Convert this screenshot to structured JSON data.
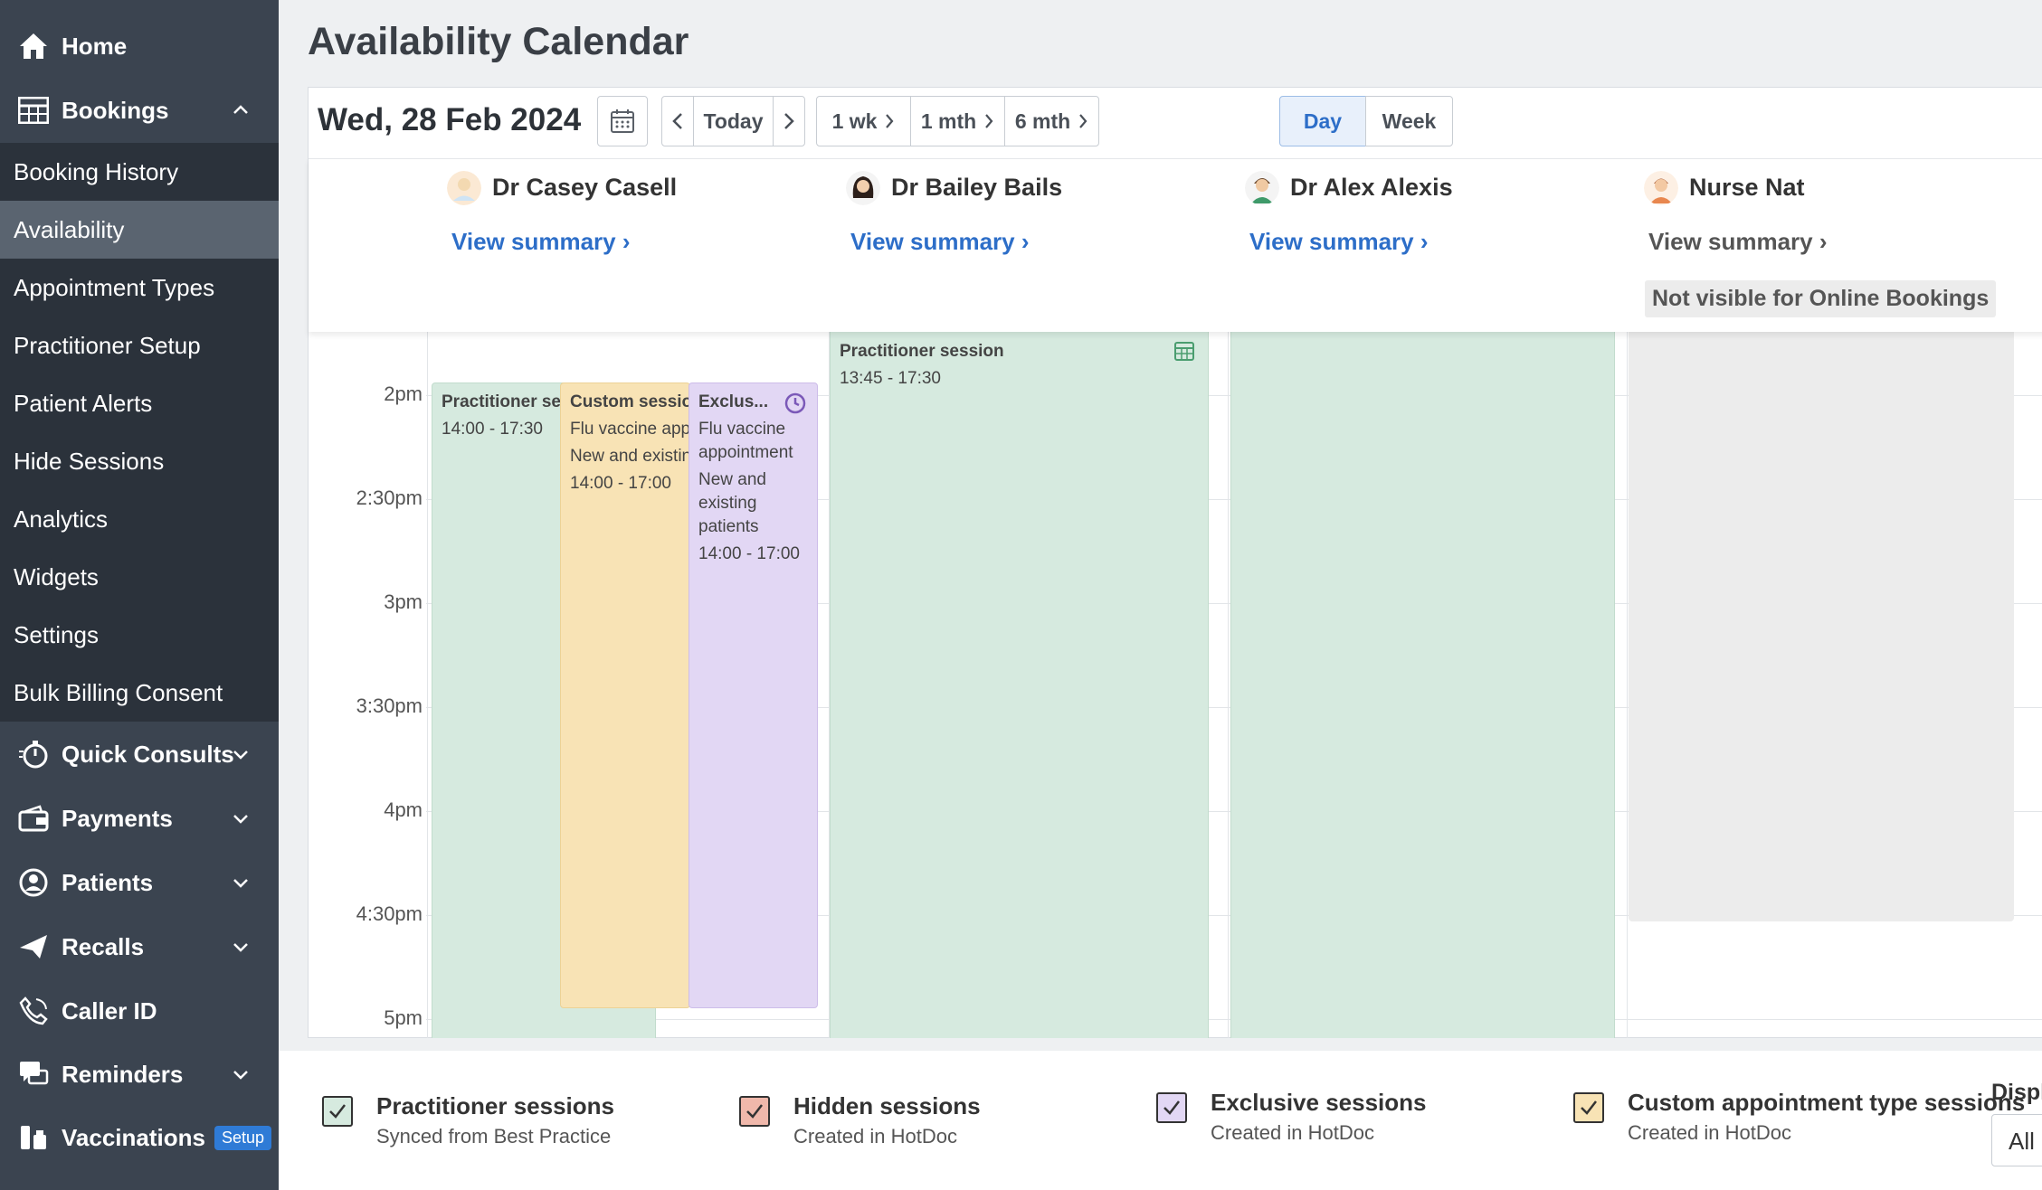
{
  "sidebar": {
    "home": "Home",
    "bookings": "Bookings",
    "bookings_sub": [
      "Booking History",
      "Availability",
      "Appointment Types",
      "Practitioner Setup",
      "Patient Alerts",
      "Hide Sessions",
      "Analytics",
      "Widgets",
      "Settings",
      "Bulk Billing Consent"
    ],
    "active_sub": "Availability",
    "quick_consults": "Quick Consults",
    "payments": "Payments",
    "patients": "Patients",
    "recalls": "Recalls",
    "caller_id": "Caller ID",
    "reminders": "Reminders",
    "vaccinations": "Vaccinations",
    "vaccinations_badge": "Setup"
  },
  "page": {
    "title": "Availability Calendar"
  },
  "toolbar": {
    "date": "Wed, 28 Feb 2024",
    "today": "Today",
    "ranges": [
      "1 wk",
      "1 mth",
      "6 mth"
    ],
    "views": [
      "Day",
      "Week"
    ],
    "active_view": "Day"
  },
  "practitioners": [
    {
      "name": "Dr Casey Casell",
      "link": "View summary"
    },
    {
      "name": "Dr Bailey Bails",
      "link": "View summary"
    },
    {
      "name": "Dr Alex Alexis",
      "link": "View summary"
    },
    {
      "name": "Nurse Nat",
      "link": "View summary",
      "notice": "Not visible for Online Bookings"
    }
  ],
  "times": [
    "2pm",
    "2:30pm",
    "3pm",
    "3:30pm",
    "4pm",
    "4:30pm",
    "5pm"
  ],
  "events": {
    "casey_practitioner": {
      "title": "Practitioner session",
      "time": "14:00 - 17:30"
    },
    "casey_custom": {
      "title": "Custom session",
      "line1": "Flu vaccine appointment",
      "line2": "New and existing patients",
      "time": "14:00 - 17:00"
    },
    "casey_exclusive": {
      "title": "Exclus...",
      "line1": "Flu vaccine appointment",
      "line2": "New and existing patients",
      "time": "14:00 - 17:00"
    },
    "bailey_practitioner": {
      "title": "Practitioner session",
      "time": "13:45 - 17:30"
    }
  },
  "legend": [
    {
      "title": "Practitioner sessions",
      "sub": "Synced from Best Practice",
      "color": "#d6eadf"
    },
    {
      "title": "Hidden sessions",
      "sub": "Created in HotDoc",
      "color": "#f0b8ab"
    },
    {
      "title": "Exclusive sessions",
      "sub": "Created in HotDoc",
      "color": "#e2d7f4"
    },
    {
      "title": "Custom appointment type sessions",
      "sub": "Created in HotDoc",
      "color": "#f8e3b5"
    }
  ],
  "display": {
    "label": "Displ",
    "value": "All"
  }
}
